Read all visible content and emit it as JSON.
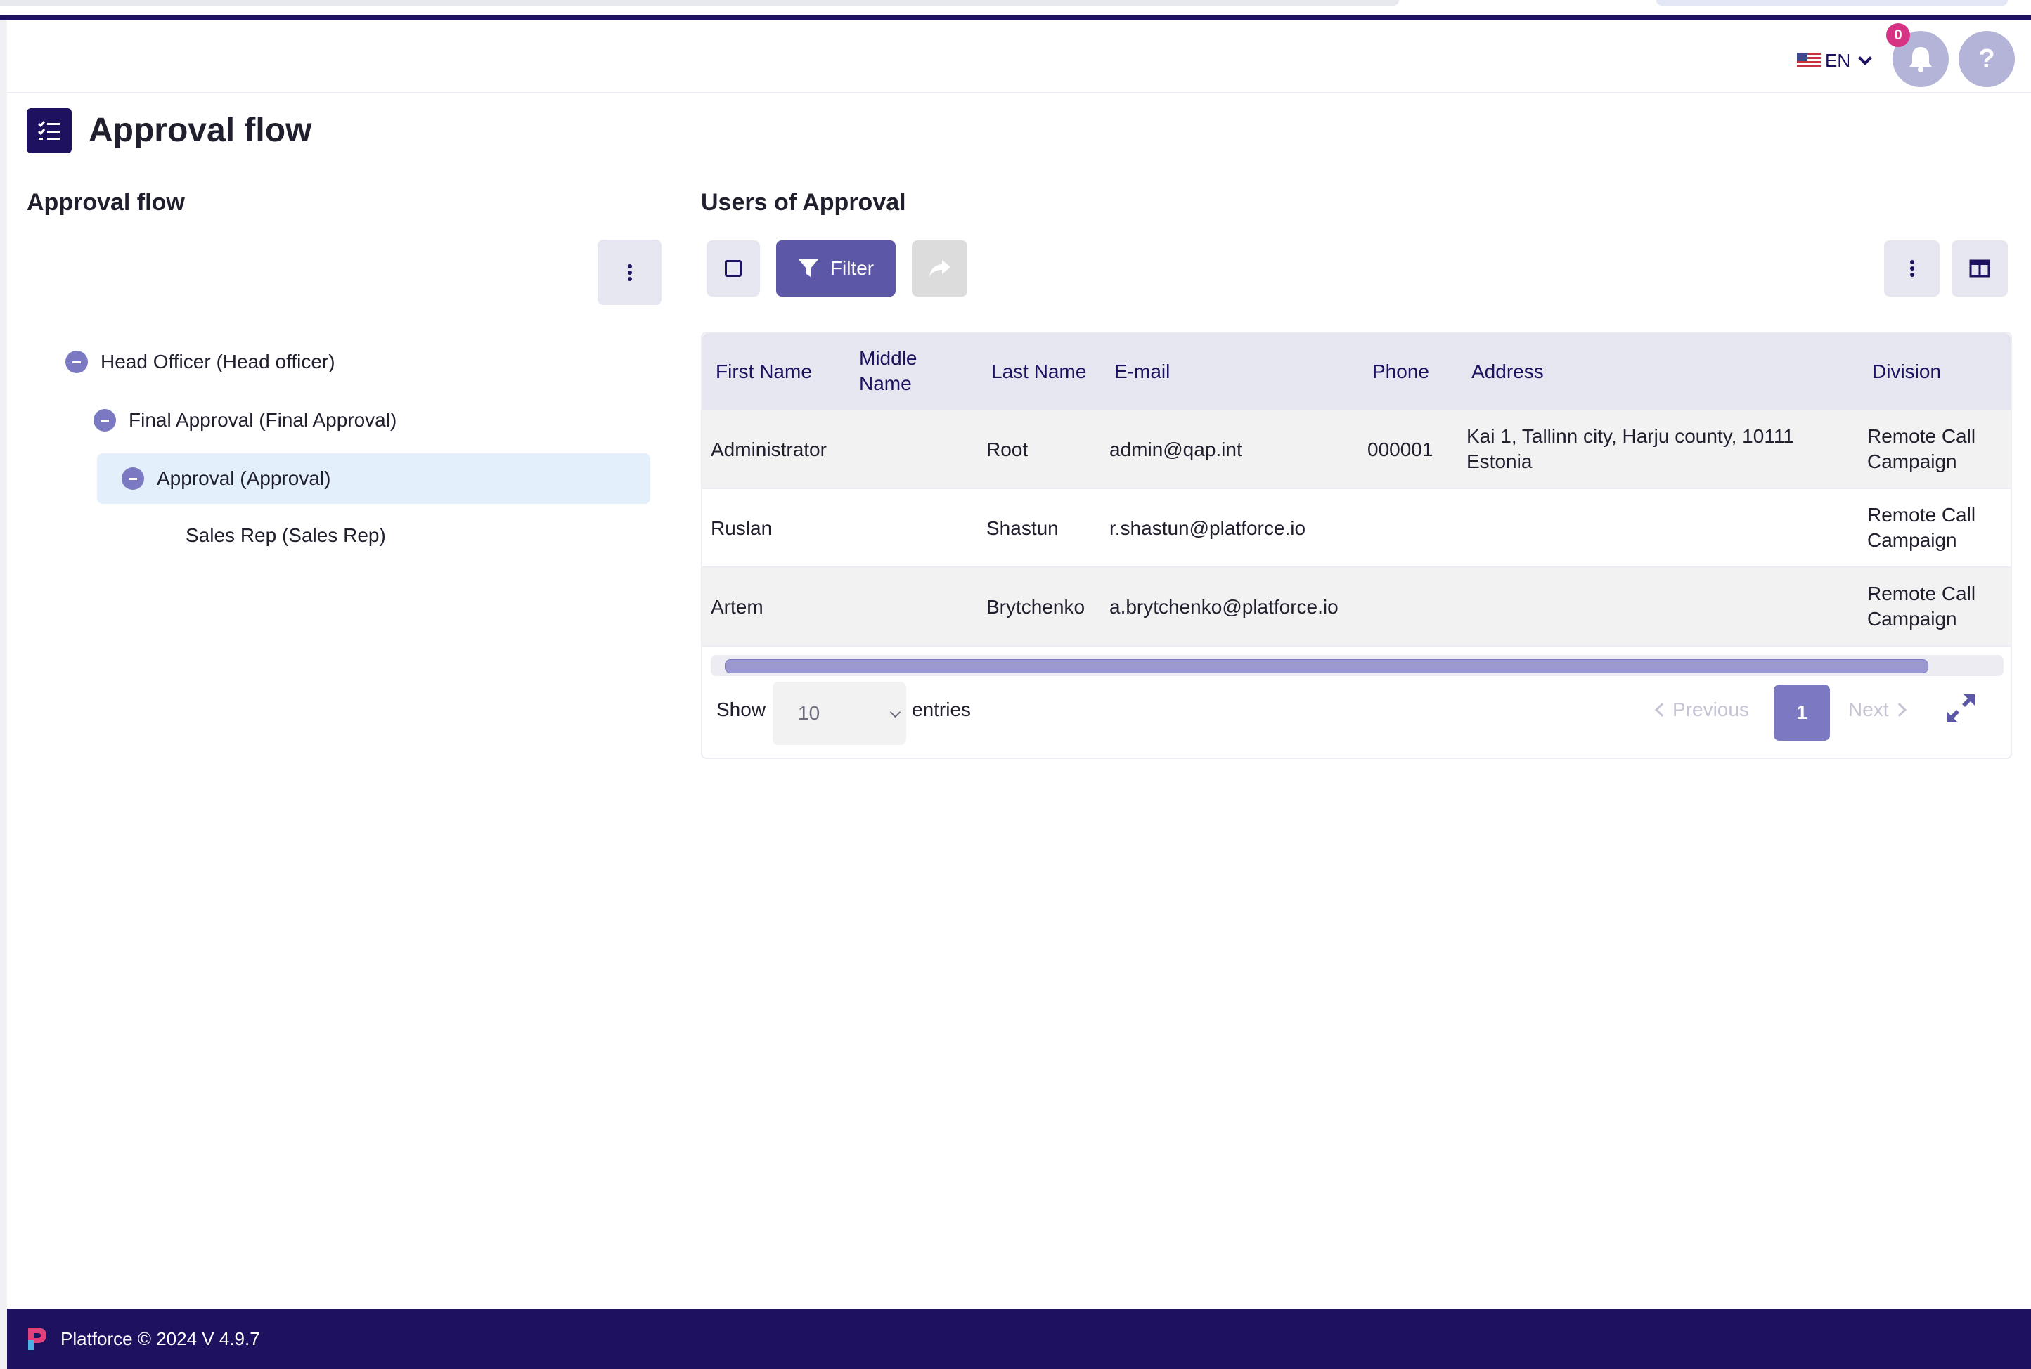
{
  "header": {
    "language": "EN",
    "notification_count": "0",
    "help_label": "?"
  },
  "page": {
    "title": "Approval flow"
  },
  "left_panel": {
    "title": "Approval flow",
    "tree": [
      {
        "label": "Head Officer (Head officer)",
        "collapsible": true
      },
      {
        "label": "Final Approval (Final Approval)",
        "collapsible": true
      },
      {
        "label": "Approval (Approval)",
        "collapsible": true,
        "selected": true
      },
      {
        "label": "Sales Rep (Sales Rep)",
        "collapsible": false
      }
    ]
  },
  "right_panel": {
    "title": "Users of Approval",
    "toolbar": {
      "filter_label": "Filter"
    },
    "table": {
      "columns": [
        "First Name",
        "Middle Name",
        "Last Name",
        "E-mail",
        "Phone",
        "Address",
        "Division"
      ],
      "rows": [
        {
          "first_name": "Administrator",
          "middle_name": "",
          "last_name": "Root",
          "email": "admin@qap.int",
          "phone": "000001",
          "address": "Kai 1, Tallinn city, Harju county, 10111 Estonia",
          "division": "Remote Call Campaign"
        },
        {
          "first_name": "Ruslan",
          "middle_name": "",
          "last_name": "Shastun",
          "email": "r.shastun@platforce.io",
          "phone": "",
          "address": "",
          "division": "Remote Call Campaign"
        },
        {
          "first_name": "Artem",
          "middle_name": "",
          "last_name": "Brytchenko",
          "email": "a.brytchenko@platforce.io",
          "phone": "",
          "address": "",
          "division": "Remote Call Campaign"
        }
      ]
    },
    "pagination": {
      "show_label": "Show",
      "page_size": "10",
      "entries_label": "entries",
      "previous_label": "Previous",
      "current_page": "1",
      "next_label": "Next"
    }
  },
  "footer": {
    "text": "Platforce © 2024 V 4.9.7"
  },
  "colors": {
    "brand_dark": "#1d1160",
    "accent": "#5d57a8",
    "accent_light": "#7b79c2",
    "badge": "#d63384"
  }
}
